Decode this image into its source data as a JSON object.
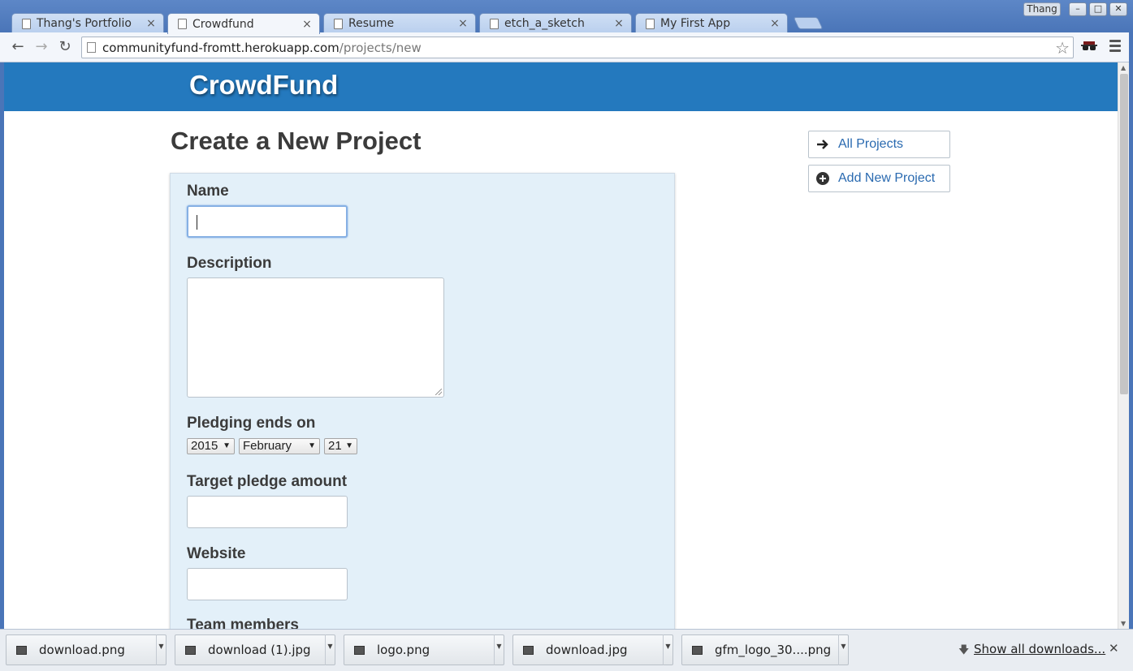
{
  "browser": {
    "tabs": [
      {
        "title": "Thang's Portfolio",
        "active": false
      },
      {
        "title": "Crowdfund",
        "active": true
      },
      {
        "title": "Resume",
        "active": false
      },
      {
        "title": "etch_a_sketch",
        "active": false
      },
      {
        "title": "My First App",
        "active": false
      }
    ],
    "close_glyph": "×",
    "profile_name": "Thang",
    "window_buttons": {
      "minimize": "–",
      "maximize": "□",
      "close": "✕"
    },
    "url_host": "communityfund-fromtt.herokuapp.com",
    "url_path": "/projects/new",
    "nav": {
      "back": "←",
      "forward": "→",
      "reload": "↻"
    },
    "star": "☆"
  },
  "site": {
    "brand": "CrowdFund",
    "header_color": "#2479be"
  },
  "page": {
    "title": "Create a New Project",
    "form": {
      "name_label": "Name",
      "name_value": "",
      "description_label": "Description",
      "description_value": "",
      "pledge_end_label": "Pledging ends on",
      "pledge_year": "2015",
      "pledge_month": "February",
      "pledge_day": "21",
      "target_label": "Target pledge amount",
      "target_value": "",
      "website_label": "Website",
      "website_value": "",
      "team_label": "Team members"
    },
    "sidebar": {
      "all_projects": "All Projects",
      "add_new_project": "Add New Project"
    }
  },
  "downloads": {
    "items": [
      {
        "name": "download.png"
      },
      {
        "name": "download (1).jpg"
      },
      {
        "name": "logo.png"
      },
      {
        "name": "download.jpg"
      },
      {
        "name": "gfm_logo_30....png"
      }
    ],
    "show_all": "Show all downloads...",
    "close": "✕"
  }
}
